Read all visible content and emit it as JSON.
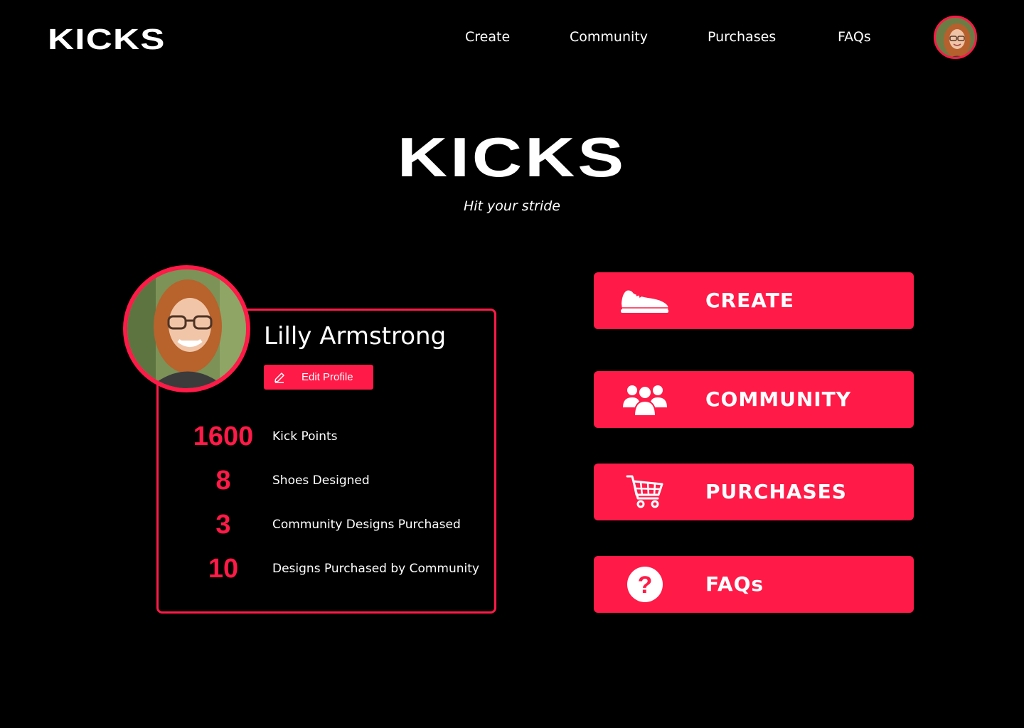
{
  "brand": {
    "name": "KICKS",
    "tagline": "Hit your stride"
  },
  "nav": {
    "links": [
      "Create",
      "Community",
      "Purchases",
      "FAQs"
    ]
  },
  "profile": {
    "name": "Lilly Armstrong",
    "edit_label": "Edit Profile",
    "stats": [
      {
        "value": "1600",
        "label": "Kick Points"
      },
      {
        "value": "8",
        "label": "Shoes Designed"
      },
      {
        "value": "3",
        "label": "Community Designs Purchased"
      },
      {
        "value": "10",
        "label": "Designs Purchased by Community"
      }
    ]
  },
  "actions": [
    {
      "label": "CREATE",
      "icon": "shoe-icon"
    },
    {
      "label": "COMMUNITY",
      "icon": "people-icon"
    },
    {
      "label": "PURCHASES",
      "icon": "cart-icon"
    },
    {
      "label": "FAQs",
      "icon": "question-icon"
    }
  ],
  "colors": {
    "accent": "#ff1a47",
    "background": "#000000",
    "text": "#ffffff"
  }
}
